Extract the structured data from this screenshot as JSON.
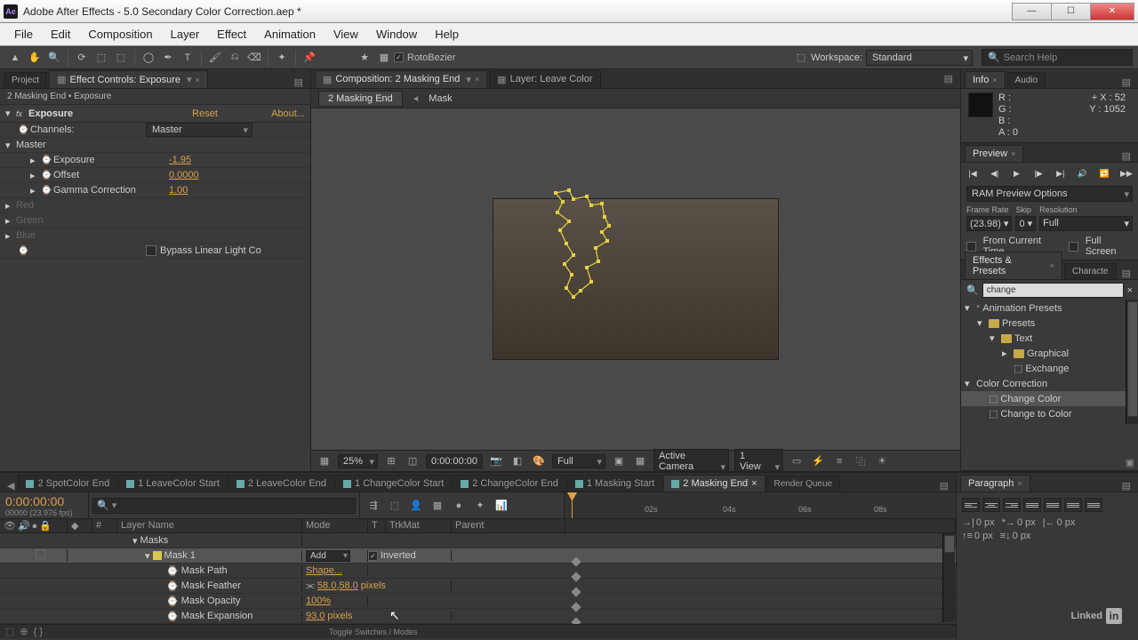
{
  "app": {
    "title": "Adobe After Effects - 5.0 Secondary Color Correction.aep *",
    "icon_text": "Ae"
  },
  "menubar": [
    "File",
    "Edit",
    "Composition",
    "Layer",
    "Effect",
    "Animation",
    "View",
    "Window",
    "Help"
  ],
  "toolbar": {
    "rotobezier_label": "RotoBezier",
    "workspace_label": "Workspace:",
    "workspace_value": "Standard",
    "search_placeholder": "Search Help"
  },
  "effect_panel": {
    "tabs": [
      "Project",
      "Effect Controls: Exposure"
    ],
    "breadcrumb": "2 Masking End • Exposure",
    "effect_name": "Exposure",
    "reset": "Reset",
    "about": "About...",
    "props": {
      "channels_label": "Channels:",
      "channels_value": "Master",
      "master_label": "Master",
      "exposure_label": "Exposure",
      "exposure_value": "-1.95",
      "offset_label": "Offset",
      "offset_value": "0.0000",
      "gamma_label": "Gamma Correction",
      "gamma_value": "1.00",
      "red_label": "Red",
      "green_label": "Green",
      "blue_label": "Blue",
      "bypass_label": "Bypass Linear Light Co"
    }
  },
  "comp_panel": {
    "tab1": "Composition: 2 Masking End",
    "tab2": "Layer: Leave Color",
    "crumb1": "2 Masking End",
    "crumb2": "Mask",
    "zoom": "25%",
    "timecode": "0:00:00:00",
    "resolution": "Full",
    "camera": "Active Camera",
    "views": "1 View"
  },
  "info_panel": {
    "tab1": "Info",
    "tab2": "Audio",
    "r": "R :",
    "g": "G :",
    "b": "B :",
    "a": "A :  0",
    "x": "X : 52",
    "y": "Y : 1052"
  },
  "preview_panel": {
    "tab": "Preview",
    "ram_options": "RAM Preview Options",
    "framerate_label": "Frame Rate",
    "framerate_value": "(23.98)",
    "skip_label": "Skip",
    "skip_value": "0",
    "resolution_label": "Resolution",
    "resolution_value": "Full",
    "from_current": "From Current Time",
    "fullscreen": "Full Screen"
  },
  "effects_presets": {
    "tab1": "Effects & Presets",
    "tab2": "Characte",
    "search": "change",
    "tree": {
      "root": "Animation Presets",
      "presets": "Presets",
      "text": "Text",
      "graphical": "Graphical",
      "exchange": "Exchange",
      "color_correction": "Color Correction",
      "change_color": "Change Color",
      "change_to_color": "Change to Color"
    }
  },
  "paragraph_panel": {
    "tab": "Paragraph",
    "indent_val": "0 px"
  },
  "timeline": {
    "tabs": [
      "2 SpotColor End",
      "1 LeaveColor Start",
      "2 LeaveColor End",
      "1 ChangeColor Start",
      "2 ChangeColor End",
      "1 Masking Start",
      "2 Masking End",
      "Render Queue"
    ],
    "active_tab_index": 6,
    "timecode": "0:00:00:00",
    "frame_info": "00000 (23.976 fps)",
    "ruler_ticks": [
      "02s",
      "04s",
      "06s",
      "08s"
    ],
    "cols": {
      "num": "#",
      "name": "Layer Name",
      "mode": "Mode",
      "t": "T",
      "trkmat": "TrkMat",
      "parent": "Parent"
    },
    "masks_label": "Masks",
    "mask1_label": "Mask 1",
    "mask1_mode": "Add",
    "inverted_label": "Inverted",
    "mask_path_label": "Mask Path",
    "mask_path_value": "Shape...",
    "mask_feather_label": "Mask Feather",
    "mask_feather_value": "58.0,58.0",
    "mask_feather_unit": "pixels",
    "mask_opacity_label": "Mask Opacity",
    "mask_opacity_value": "100%",
    "mask_expansion_label": "Mask Expansion",
    "mask_expansion_value": "93.0",
    "mask_expansion_unit": "pixels",
    "toggle_label": "Toggle Switches / Modes"
  }
}
